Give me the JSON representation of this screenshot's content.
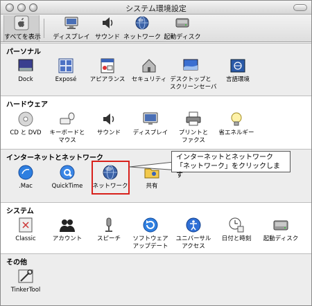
{
  "window": {
    "title": "システム環境設定"
  },
  "toolbar": {
    "items": [
      {
        "label": "すべてを表示",
        "icon": "apple-grid-icon"
      },
      {
        "label": "ディスプレイ",
        "icon": "display-icon"
      },
      {
        "label": "サウンド",
        "icon": "speaker-icon"
      },
      {
        "label": "ネットワーク",
        "icon": "network-globe-icon"
      },
      {
        "label": "起動ディスク",
        "icon": "startup-disk-icon"
      }
    ]
  },
  "sections": {
    "personal": {
      "title": "パーソナル",
      "items": [
        {
          "label": "Dock"
        },
        {
          "label": "Exposé"
        },
        {
          "label": "アピアランス"
        },
        {
          "label": "セキュリティ"
        },
        {
          "label": "デスクトップと",
          "label2": "スクリーンセーバ"
        },
        {
          "label": "言語環境"
        }
      ]
    },
    "hardware": {
      "title": "ハードウェア",
      "items": [
        {
          "label": "CD と DVD"
        },
        {
          "label": "キーボードと",
          "label2": "マウス"
        },
        {
          "label": "サウンド"
        },
        {
          "label": "ディスプレイ"
        },
        {
          "label": "プリントと",
          "label2": "ファクス"
        },
        {
          "label": "省エネルギー"
        }
      ]
    },
    "internet": {
      "title": "インターネットとネットワーク",
      "items": [
        {
          "label": ".Mac"
        },
        {
          "label": "QuickTime"
        },
        {
          "label": "ネットワーク"
        },
        {
          "label": "共有"
        }
      ]
    },
    "system": {
      "title": "システム",
      "items": [
        {
          "label": "Classic"
        },
        {
          "label": "アカウント"
        },
        {
          "label": "スピーチ"
        },
        {
          "label": "ソフトウェア",
          "label2": "アップデート"
        },
        {
          "label": "ユニバーサル",
          "label2": "アクセス"
        },
        {
          "label": "日付と時刻"
        },
        {
          "label": "起動ディスク"
        }
      ]
    },
    "other": {
      "title": "その他",
      "items": [
        {
          "label": "TinkerTool"
        }
      ]
    }
  },
  "annotation": {
    "line1": "インターネットとネットワーク",
    "line2": "「ネットワーク」をクリックします"
  },
  "colors": {
    "highlight": "#d8201b",
    "aqua": "#2f7fe0"
  }
}
